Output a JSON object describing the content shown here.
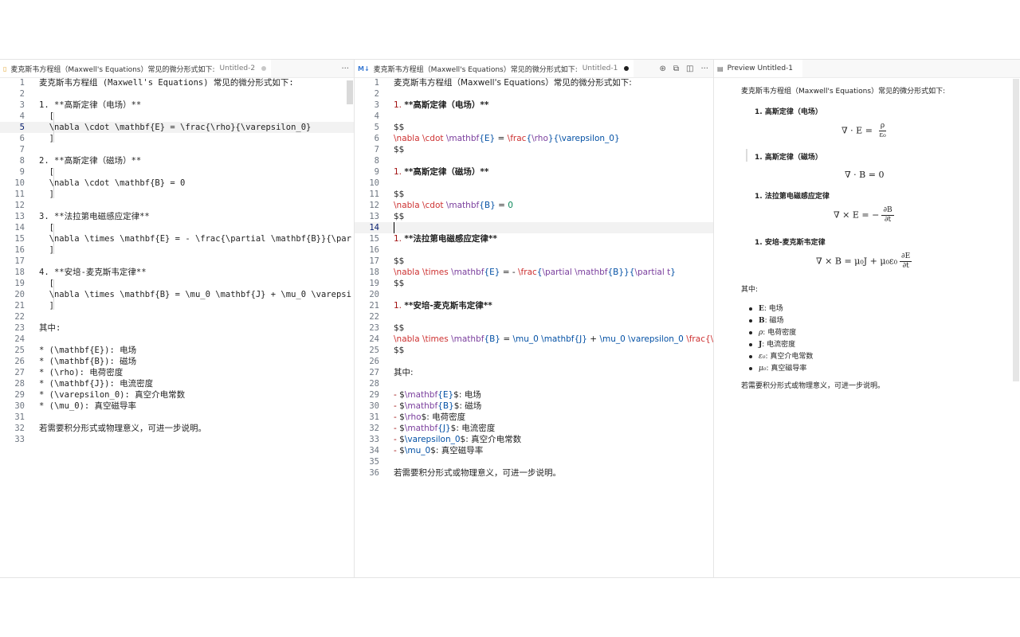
{
  "pane1": {
    "tab": {
      "title": "麦克斯韦方程组（Maxwell's Equations）常见的微分形式如下:",
      "desc": "Untitled-2",
      "dirty_icon": "dot-icon"
    },
    "more_icon": "ellipsis-icon",
    "lines": [
      {
        "n": "1",
        "segs": [
          {
            "t": "麦克斯韦方程组 (Maxwell's Equations) 常见的微分形式如下:"
          }
        ]
      },
      {
        "n": "2",
        "segs": []
      },
      {
        "n": "3",
        "segs": [
          {
            "t": "1. **高斯定律（电场）**"
          }
        ]
      },
      {
        "n": "4",
        "segs": [
          {
            "t": "  ["
          }
        ]
      },
      {
        "n": "5",
        "segs": [
          {
            "t": "  \\nabla \\cdot \\mathbf{E} = \\frac{\\rho}{\\varepsilon_0}"
          }
        ]
      },
      {
        "n": "6",
        "segs": [
          {
            "t": "  ]"
          }
        ]
      },
      {
        "n": "7",
        "segs": []
      },
      {
        "n": "8",
        "segs": [
          {
            "t": "2. **高斯定律（磁场）**"
          }
        ]
      },
      {
        "n": "9",
        "segs": [
          {
            "t": "  ["
          }
        ]
      },
      {
        "n": "10",
        "segs": [
          {
            "t": "  \\nabla \\cdot \\mathbf{B} = 0"
          }
        ]
      },
      {
        "n": "11",
        "segs": [
          {
            "t": "  ]"
          }
        ]
      },
      {
        "n": "12",
        "segs": []
      },
      {
        "n": "13",
        "segs": [
          {
            "t": "3. **法拉第电磁感应定律**"
          }
        ]
      },
      {
        "n": "14",
        "segs": [
          {
            "t": "  ["
          }
        ]
      },
      {
        "n": "15",
        "segs": [
          {
            "t": "  \\nabla \\times \\mathbf{E} = - \\frac{\\partial \\mathbf{B}}{\\par"
          }
        ]
      },
      {
        "n": "16",
        "segs": [
          {
            "t": "  ]"
          }
        ]
      },
      {
        "n": "17",
        "segs": []
      },
      {
        "n": "18",
        "segs": [
          {
            "t": "4. **安培-麦克斯韦定律**"
          }
        ]
      },
      {
        "n": "19",
        "segs": [
          {
            "t": "  ["
          }
        ]
      },
      {
        "n": "20",
        "segs": [
          {
            "t": "  \\nabla \\times \\mathbf{B} = \\mu_0 \\mathbf{J} + \\mu_0 \\varepsi"
          }
        ]
      },
      {
        "n": "21",
        "segs": [
          {
            "t": "  ]"
          }
        ]
      },
      {
        "n": "22",
        "segs": []
      },
      {
        "n": "23",
        "segs": [
          {
            "t": "其中:"
          }
        ]
      },
      {
        "n": "24",
        "segs": []
      },
      {
        "n": "25",
        "segs": [
          {
            "t": "* (\\mathbf{E}): 电场"
          }
        ]
      },
      {
        "n": "26",
        "segs": [
          {
            "t": "* (\\mathbf{B}): 磁场"
          }
        ]
      },
      {
        "n": "27",
        "segs": [
          {
            "t": "* (\\rho): 电荷密度"
          }
        ]
      },
      {
        "n": "28",
        "segs": [
          {
            "t": "* (\\mathbf{J}): 电流密度"
          }
        ]
      },
      {
        "n": "29",
        "segs": [
          {
            "t": "* (\\varepsilon_0): 真空介电常数"
          }
        ]
      },
      {
        "n": "30",
        "segs": [
          {
            "t": "* (\\mu_0): 真空磁导率"
          }
        ]
      },
      {
        "n": "31",
        "segs": []
      },
      {
        "n": "32",
        "segs": [
          {
            "t": "若需要积分形式或物理意义，可进一步说明。"
          }
        ]
      },
      {
        "n": "33",
        "segs": []
      }
    ],
    "current_line": "5"
  },
  "pane2": {
    "tab": {
      "icon": "markdown-icon",
      "icon_text": "M↓",
      "title": "麦克斯韦方程组（Maxwell's Equations）常见的微分形式如下:",
      "desc": "Untitled-1",
      "dirty_icon": "dot-icon"
    },
    "actions": [
      {
        "name": "copilot-icon",
        "glyph": "⊛"
      },
      {
        "name": "open-preview-icon",
        "glyph": "⧉"
      },
      {
        "name": "split-editor-icon",
        "glyph": "◫"
      },
      {
        "name": "more-actions-icon",
        "glyph": "···"
      }
    ],
    "lines": [
      {
        "n": "1",
        "segs": [
          {
            "t": "麦克斯韦方程组（Maxwell's Equations）常见的微分形式如下:"
          }
        ]
      },
      {
        "n": "2",
        "segs": []
      },
      {
        "n": "3",
        "segs": [
          {
            "t": "1. ",
            "c": "mk"
          },
          {
            "t": "**高斯定律（电场）**",
            "c": "bold"
          }
        ]
      },
      {
        "n": "4",
        "segs": []
      },
      {
        "n": "5",
        "segs": [
          {
            "t": "$$"
          }
        ]
      },
      {
        "n": "6",
        "segs": [
          {
            "t": "\\nabla \\cdot ",
            "c": "kw"
          },
          {
            "t": "\\mathbf",
            "c": "fn"
          },
          {
            "t": "{E}",
            "c": "br"
          },
          {
            "t": " = "
          },
          {
            "t": "\\frac",
            "c": "kw"
          },
          {
            "t": "{",
            "c": "br"
          },
          {
            "t": "\\rho",
            "c": "fn"
          },
          {
            "t": "}{\\varepsilon_0}",
            "c": "br"
          }
        ]
      },
      {
        "n": "7",
        "segs": [
          {
            "t": "$$"
          }
        ]
      },
      {
        "n": "8",
        "segs": []
      },
      {
        "n": "9",
        "segs": [
          {
            "t": "1. ",
            "c": "mk"
          },
          {
            "t": "**高斯定律（磁场）**",
            "c": "bold"
          }
        ]
      },
      {
        "n": "10",
        "segs": []
      },
      {
        "n": "11",
        "segs": [
          {
            "t": "$$"
          }
        ]
      },
      {
        "n": "12",
        "segs": [
          {
            "t": "\\nabla \\cdot ",
            "c": "kw"
          },
          {
            "t": "\\mathbf",
            "c": "fn"
          },
          {
            "t": "{B}",
            "c": "br"
          },
          {
            "t": " = "
          },
          {
            "t": "0",
            "c": "num"
          }
        ]
      },
      {
        "n": "13",
        "segs": [
          {
            "t": "$$"
          }
        ]
      },
      {
        "n": "14",
        "segs": []
      },
      {
        "n": "15",
        "segs": [
          {
            "t": "1. ",
            "c": "mk"
          },
          {
            "t": "**法拉第电磁感应定律**",
            "c": "bold"
          }
        ]
      },
      {
        "n": "16",
        "segs": []
      },
      {
        "n": "17",
        "segs": [
          {
            "t": "$$"
          }
        ]
      },
      {
        "n": "18",
        "segs": [
          {
            "t": "\\nabla \\times ",
            "c": "kw"
          },
          {
            "t": "\\mathbf",
            "c": "fn"
          },
          {
            "t": "{E}",
            "c": "br"
          },
          {
            "t": " = - "
          },
          {
            "t": "\\frac",
            "c": "kw"
          },
          {
            "t": "{",
            "c": "br"
          },
          {
            "t": "\\partial \\mathbf",
            "c": "fn"
          },
          {
            "t": "{B}}{",
            "c": "br"
          },
          {
            "t": "\\partial t",
            "c": "fn"
          },
          {
            "t": "}",
            "c": "br"
          }
        ]
      },
      {
        "n": "19",
        "segs": [
          {
            "t": "$$"
          }
        ]
      },
      {
        "n": "20",
        "segs": []
      },
      {
        "n": "21",
        "segs": [
          {
            "t": "1. ",
            "c": "mk"
          },
          {
            "t": "**安培-麦克斯韦定律**",
            "c": "bold"
          }
        ]
      },
      {
        "n": "22",
        "segs": []
      },
      {
        "n": "23",
        "segs": [
          {
            "t": "$$"
          }
        ]
      },
      {
        "n": "24",
        "segs": [
          {
            "t": "\\nabla \\times ",
            "c": "kw"
          },
          {
            "t": "\\mathbf",
            "c": "fn"
          },
          {
            "t": "{B}",
            "c": "br"
          },
          {
            "t": " = "
          },
          {
            "t": "\\mu_0 \\mathbf",
            "c": "br"
          },
          {
            "t": "{J}",
            "c": "br"
          },
          {
            "t": " + "
          },
          {
            "t": "\\mu_0 \\varepsilon_0 ",
            "c": "br"
          },
          {
            "t": "\\frac{\\par",
            "c": "kw"
          }
        ]
      },
      {
        "n": "25",
        "segs": [
          {
            "t": "$$"
          }
        ]
      },
      {
        "n": "26",
        "segs": []
      },
      {
        "n": "27",
        "segs": [
          {
            "t": "其中:"
          }
        ]
      },
      {
        "n": "28",
        "segs": []
      },
      {
        "n": "29",
        "segs": [
          {
            "t": "- ",
            "c": "mk"
          },
          {
            "t": "$"
          },
          {
            "t": "\\mathbf",
            "c": "fn"
          },
          {
            "t": "{E}",
            "c": "br"
          },
          {
            "t": "$: 电场"
          }
        ]
      },
      {
        "n": "30",
        "segs": [
          {
            "t": "- ",
            "c": "mk"
          },
          {
            "t": "$"
          },
          {
            "t": "\\mathbf",
            "c": "fn"
          },
          {
            "t": "{B}",
            "c": "br"
          },
          {
            "t": "$: 磁场"
          }
        ]
      },
      {
        "n": "31",
        "segs": [
          {
            "t": "- ",
            "c": "mk"
          },
          {
            "t": "$"
          },
          {
            "t": "\\rho",
            "c": "fn"
          },
          {
            "t": "$: 电荷密度"
          }
        ]
      },
      {
        "n": "32",
        "segs": [
          {
            "t": "- ",
            "c": "mk"
          },
          {
            "t": "$"
          },
          {
            "t": "\\mathbf",
            "c": "fn"
          },
          {
            "t": "{J}",
            "c": "br"
          },
          {
            "t": "$: 电流密度"
          }
        ]
      },
      {
        "n": "33",
        "segs": [
          {
            "t": "- ",
            "c": "mk"
          },
          {
            "t": "$"
          },
          {
            "t": "\\varepsilon_0",
            "c": "br"
          },
          {
            "t": "$: 真空介电常数"
          }
        ]
      },
      {
        "n": "34",
        "segs": [
          {
            "t": "- ",
            "c": "mk"
          },
          {
            "t": "$"
          },
          {
            "t": "\\mu_0",
            "c": "br"
          },
          {
            "t": "$: 真空磁导率"
          }
        ]
      },
      {
        "n": "35",
        "segs": []
      },
      {
        "n": "36",
        "segs": [
          {
            "t": "若需要积分形式或物理意义，可进一步说明。"
          }
        ]
      }
    ],
    "current_line": "14"
  },
  "pane3": {
    "tab": {
      "icon": "preview-icon",
      "title": "Preview Untitled-1"
    },
    "intro": "麦克斯韦方程组（Maxwell's Equations）常见的微分形式如下:",
    "laws": [
      {
        "num": "1.",
        "title": "高斯定律（电场）",
        "lhs": "∇ · E = ",
        "frac_num": "ρ",
        "frac_den": "ε₀"
      },
      {
        "num": "1.",
        "title": "高斯定律（磁场）",
        "eq": "∇ · B = 0"
      },
      {
        "num": "1.",
        "title": "法拉第电磁感应定律",
        "lhs": "∇ × E = −",
        "frac_num": "∂B",
        "frac_den": "∂t"
      },
      {
        "num": "1.",
        "title": "安培-麦克斯韦定律",
        "lhs": "∇ × B = μ₀J + μ₀ε₀",
        "frac_num": "∂E",
        "frac_den": "∂t"
      }
    ],
    "where": "其中:",
    "items": [
      {
        "sym": "E",
        "text": ": 电场"
      },
      {
        "sym": "B",
        "text": ": 磁场"
      },
      {
        "sym": "ρ",
        "text": ": 电荷密度"
      },
      {
        "sym": "J",
        "text": ": 电流密度"
      },
      {
        "sym": "ε₀",
        "text": ": 真空介电常数"
      },
      {
        "sym": "μ₀",
        "text": ": 真空磁导率"
      }
    ],
    "outro": "若需要积分形式或物理意义，可进一步说明。"
  }
}
